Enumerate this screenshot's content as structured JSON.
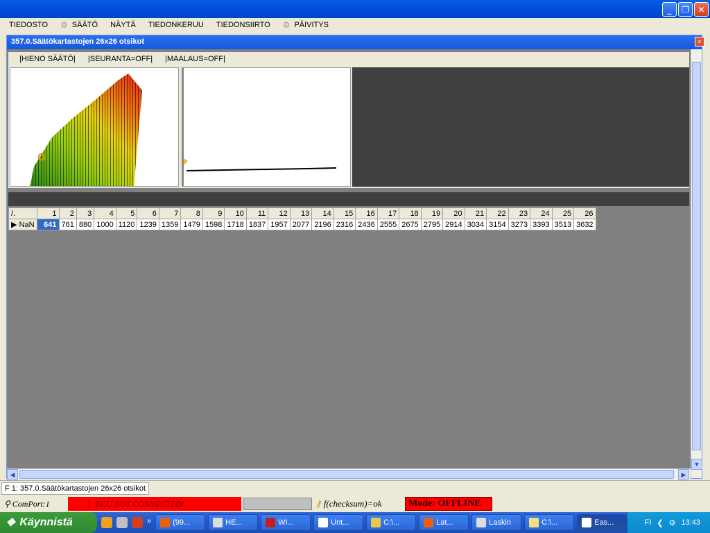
{
  "menu": [
    "TIEDOSTO",
    "SÄÄTÖ",
    "NÄYTÄ",
    "TIEDONKERUU",
    "TIEDONSIIRTO",
    "PÄIVITYS"
  ],
  "child": {
    "title": "357.0.Säätökartastojen 26x26 otsikot",
    "close": "×"
  },
  "toolbar": [
    "|HIENO SÄÄTÖ|",
    "|SEURANTA=OFF|",
    "|MAALAUS=OFF|"
  ],
  "table": {
    "corner": "/.",
    "headers": [
      "1",
      "2",
      "3",
      "4",
      "5",
      "6",
      "7",
      "8",
      "9",
      "10",
      "11",
      "12",
      "13",
      "14",
      "15",
      "16",
      "17",
      "18",
      "19",
      "20",
      "21",
      "22",
      "23",
      "24",
      "25",
      "26"
    ],
    "row_label": "NaN",
    "values": [
      "641",
      "761",
      "880",
      "1000",
      "1120",
      "1239",
      "1359",
      "1479",
      "1598",
      "1718",
      "1837",
      "1957",
      "2077",
      "2196",
      "2316",
      "2436",
      "2555",
      "2675",
      "2795",
      "2914",
      "3034",
      "3154",
      "3273",
      "3393",
      "3513",
      "3632"
    ]
  },
  "tab": "F 1:   357.0.Säätökartastojen 26x26 otsikot",
  "status": {
    "com": "ComPort:1",
    "err": "ECU NOT CONNECTED!",
    "err_icon": "!",
    "checksum": "f(checksum)=ok",
    "mode": "Mode: OFFLINE"
  },
  "taskbar": {
    "start": "Käynnistä",
    "items": [
      "(99...",
      "HE...",
      "WI...",
      "Unt...",
      "C:\\...",
      "Lat...",
      "Laskin",
      "C:\\...",
      "Eas..."
    ],
    "lang": "FI",
    "time": "13:43"
  }
}
